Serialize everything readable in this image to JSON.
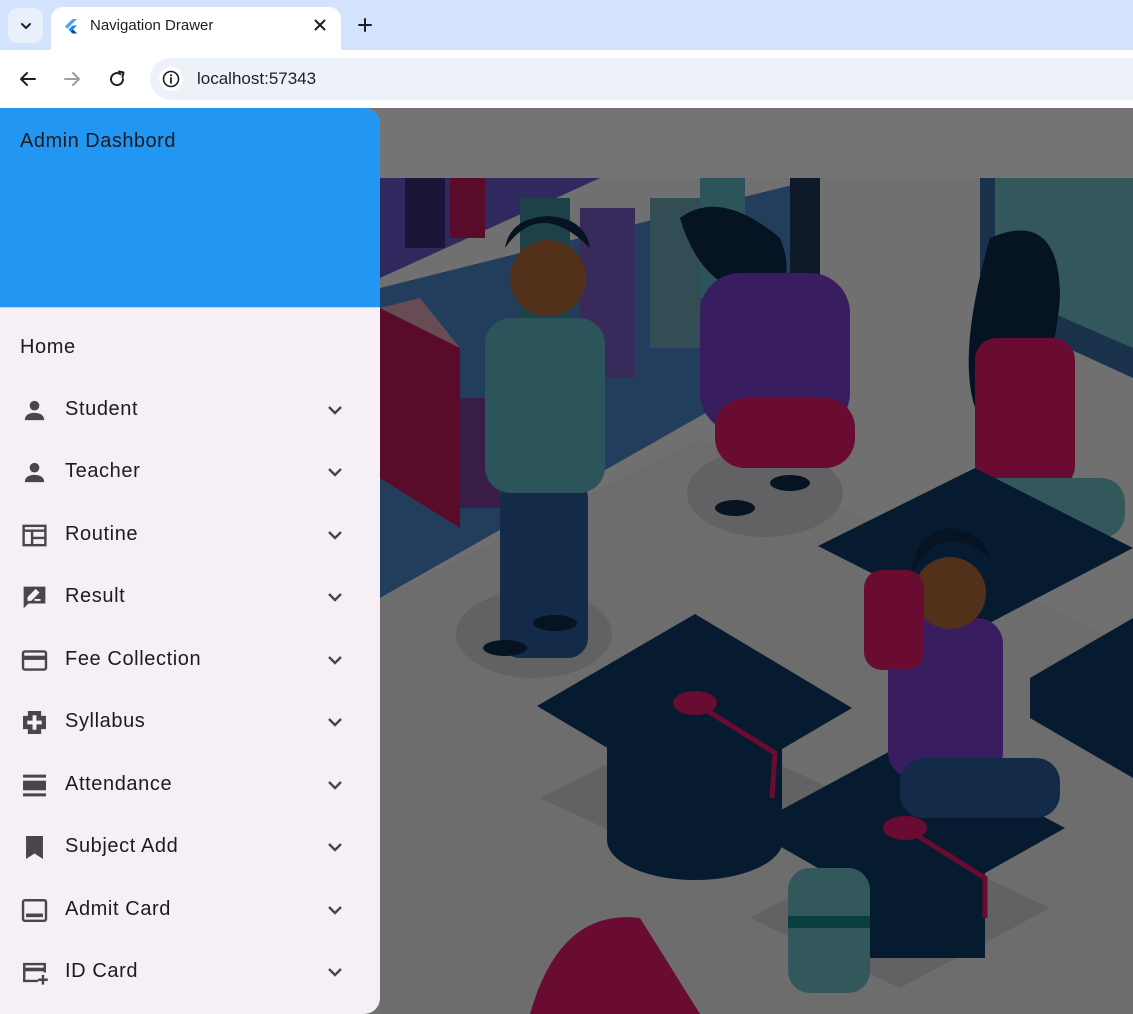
{
  "browser": {
    "tab_title": "Navigation Drawer",
    "url": "localhost:57343",
    "icons": {
      "tab_list": "chevron-down-icon",
      "favicon": "flutter-icon",
      "close": "close-icon",
      "new_tab": "plus-icon",
      "back": "arrow-left-icon",
      "forward": "arrow-right-icon",
      "reload": "reload-icon",
      "site_info": "info-icon"
    }
  },
  "drawer": {
    "header_title": "Admin Dashbord",
    "header_color": "#2196f3",
    "home_label": "Home",
    "items": [
      {
        "label": "Student",
        "icon": "person-icon"
      },
      {
        "label": "Teacher",
        "icon": "person-icon"
      },
      {
        "label": "Routine",
        "icon": "table-layout-icon"
      },
      {
        "label": "Result",
        "icon": "rate-review-icon"
      },
      {
        "label": "Fee Collection",
        "icon": "credit-card-icon"
      },
      {
        "label": "Syllabus",
        "icon": "medical-services-icon"
      },
      {
        "label": "Attendance",
        "icon": "calendar-view-day-icon"
      },
      {
        "label": "Subject Add",
        "icon": "bookmark-icon"
      },
      {
        "label": "Admit Card",
        "icon": "laptop-icon"
      },
      {
        "label": "ID Card",
        "icon": "add-card-icon"
      }
    ]
  },
  "background": {
    "illustration": "classroom-library-illustration",
    "scrim": "rgba(0,0,0,0.54)"
  }
}
